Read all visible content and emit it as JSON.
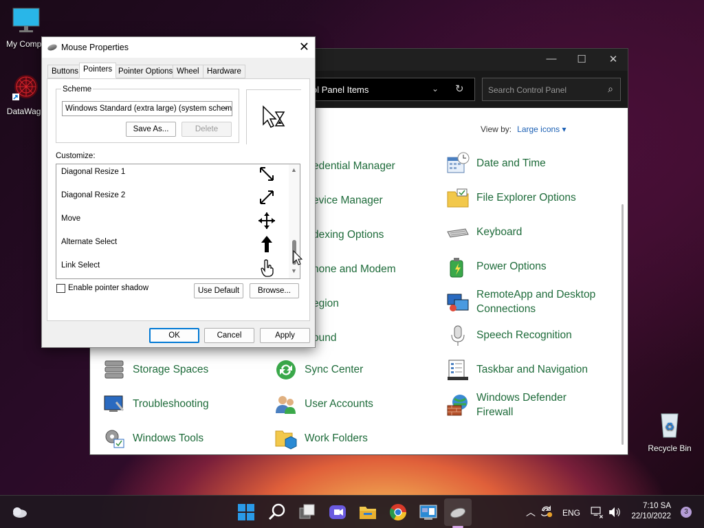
{
  "desktop": {
    "icons": [
      {
        "label": "My Compu",
        "icon": "monitor-icon"
      },
      {
        "label": "DataWago",
        "icon": "datawagon-icon"
      },
      {
        "label": "Recycle Bin",
        "icon": "recycle-bin-icon"
      }
    ]
  },
  "control_panel": {
    "address_text": "ol Panel Items",
    "search_placeholder": "Search Control Panel",
    "view_by_label": "View by:",
    "view_by_value": "Large icons",
    "items": [
      {
        "label": "edential Manager",
        "icon": "credential-icon"
      },
      {
        "label": "Date and Time",
        "icon": "calendar-clock-icon"
      },
      {
        "label": "evice Manager",
        "icon": "device-manager-icon"
      },
      {
        "label": "File Explorer Options",
        "icon": "folder-options-icon"
      },
      {
        "label": "dexing Options",
        "icon": "indexing-icon"
      },
      {
        "label": "Keyboard",
        "icon": "keyboard-icon"
      },
      {
        "label": "hone and Modem",
        "icon": "phone-icon"
      },
      {
        "label": "Power Options",
        "icon": "power-icon"
      },
      {
        "label": "egion",
        "icon": "region-icon"
      },
      {
        "label": "RemoteApp and Desktop Connections",
        "icon": "remoteapp-icon"
      },
      {
        "label": "ound",
        "icon": "sound-icon"
      },
      {
        "label": "Speech Recognition",
        "icon": "microphone-icon"
      },
      {
        "label": "Storage Spaces",
        "icon": "storage-icon"
      },
      {
        "label": "Sync Center",
        "icon": "sync-icon"
      },
      {
        "label": "Taskbar and Navigation",
        "icon": "taskbar-icon"
      },
      {
        "label": "Troubleshooting",
        "icon": "troubleshoot-icon"
      },
      {
        "label": "User Accounts",
        "icon": "users-icon"
      },
      {
        "label": "Windows Defender Firewall",
        "icon": "firewall-icon"
      },
      {
        "label": "Windows Tools",
        "icon": "tools-icon"
      },
      {
        "label": "Work Folders",
        "icon": "work-folders-icon"
      }
    ]
  },
  "dialog": {
    "title": "Mouse Properties",
    "tabs": [
      "Buttons",
      "Pointers",
      "Pointer Options",
      "Wheel",
      "Hardware"
    ],
    "active_tab": "Pointers",
    "scheme_label": "Scheme",
    "scheme_value": "Windows Standard (extra large) (system scheme",
    "save_as_label": "Save As...",
    "delete_label": "Delete",
    "customize_label": "Customize:",
    "pointers": [
      {
        "name": "Diagonal Resize 1",
        "icon": "diagonal-resize-1-icon"
      },
      {
        "name": "Diagonal Resize 2",
        "icon": "diagonal-resize-2-icon"
      },
      {
        "name": "Move",
        "icon": "move-icon"
      },
      {
        "name": "Alternate Select",
        "icon": "up-arrow-icon"
      },
      {
        "name": "Link Select",
        "icon": "hand-icon"
      }
    ],
    "enable_shadow_label": "Enable pointer shadow",
    "enable_shadow_checked": false,
    "use_default_label": "Use Default",
    "browse_label": "Browse...",
    "ok_label": "OK",
    "cancel_label": "Cancel",
    "apply_label": "Apply"
  },
  "taskbar": {
    "language": "ENG",
    "time": "7:10 SA",
    "date": "22/10/2022",
    "notification_count": "3"
  }
}
